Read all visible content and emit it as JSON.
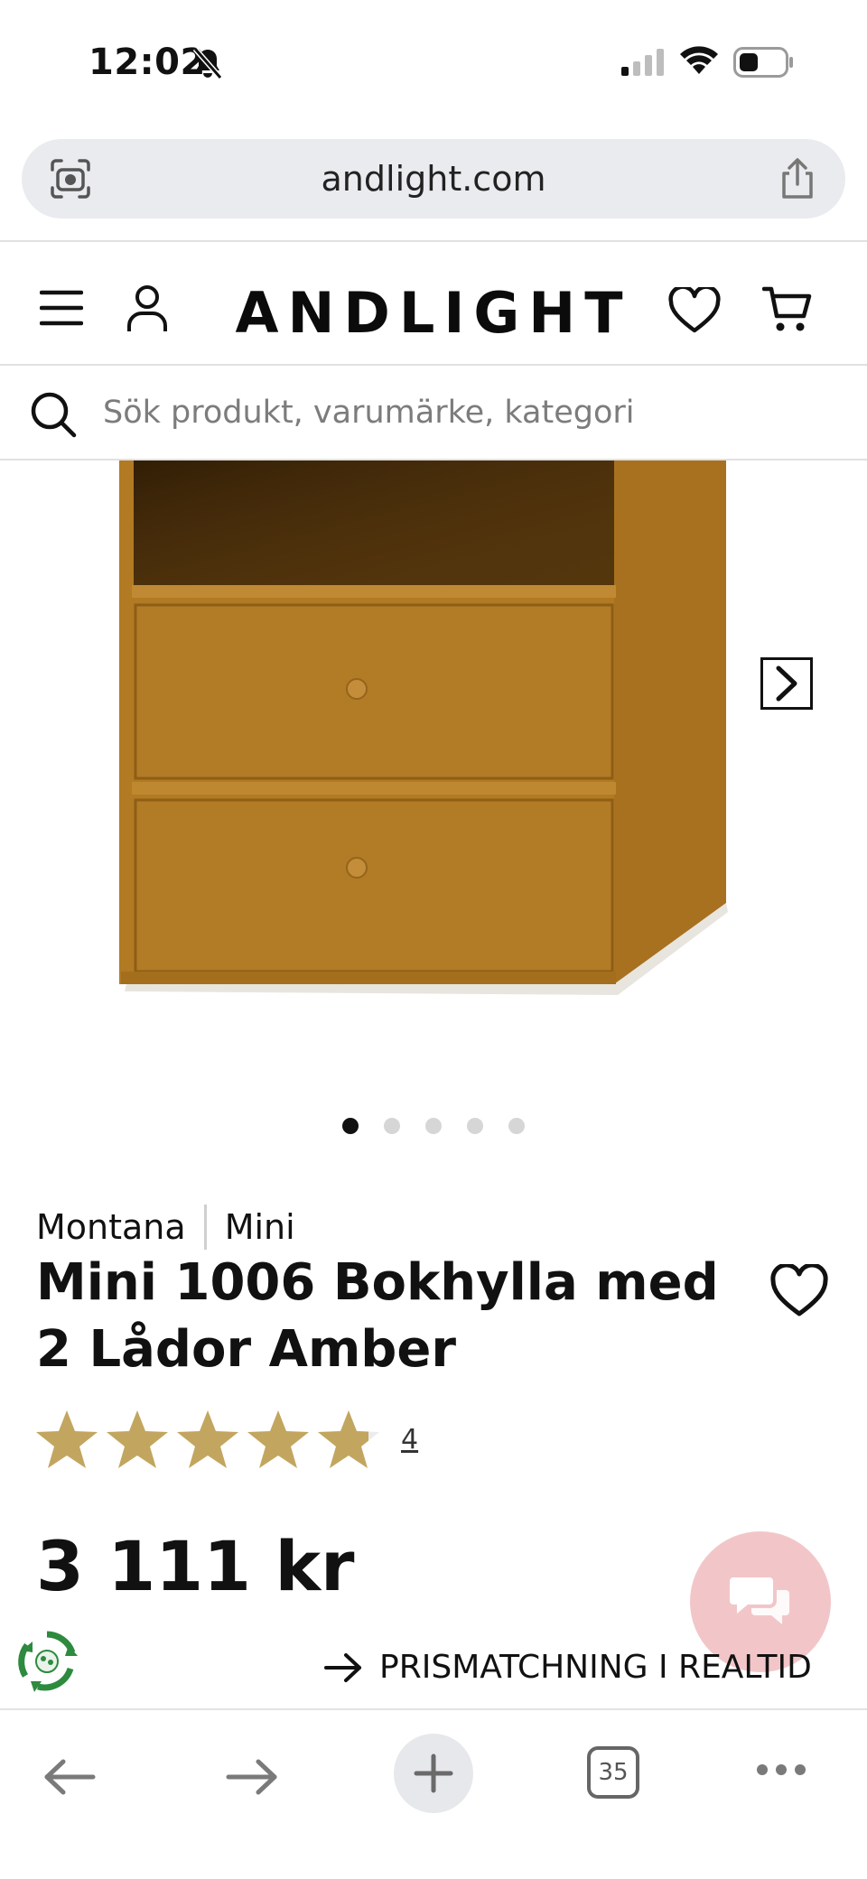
{
  "status_bar": {
    "time": "12:02",
    "icons": [
      "bell-slash-icon",
      "signal-icon",
      "wifi-icon",
      "battery-icon"
    ]
  },
  "browser": {
    "url": "andlight.com",
    "tab_count": "35",
    "icons": [
      "lens-icon",
      "share-icon",
      "back-arrow-icon",
      "forward-arrow-icon",
      "plus-icon",
      "tabs-icon",
      "more-icon"
    ]
  },
  "header": {
    "logo": "ANDLIGHT",
    "icons": [
      "menu-icon",
      "user-icon",
      "heart-icon",
      "cart-icon"
    ]
  },
  "search": {
    "placeholder": "Sök produkt, varumärke, kategori"
  },
  "gallery": {
    "image_count": 5,
    "active_index": 0
  },
  "product": {
    "brand": "Montana",
    "series": "Mini",
    "title": "Mini 1006 Bokhylla med 2 Lådor Amber",
    "rating": 4.8,
    "rating_max": 5,
    "review_count": "4",
    "price": "3 111 kr",
    "price_match": "PRISMATCHNING I REALTID"
  },
  "colors": {
    "amber": "#b17a23",
    "star": "#c2a65f",
    "chat_bubble": "#f2c6c8",
    "eco_green": "#2d8a3e"
  }
}
